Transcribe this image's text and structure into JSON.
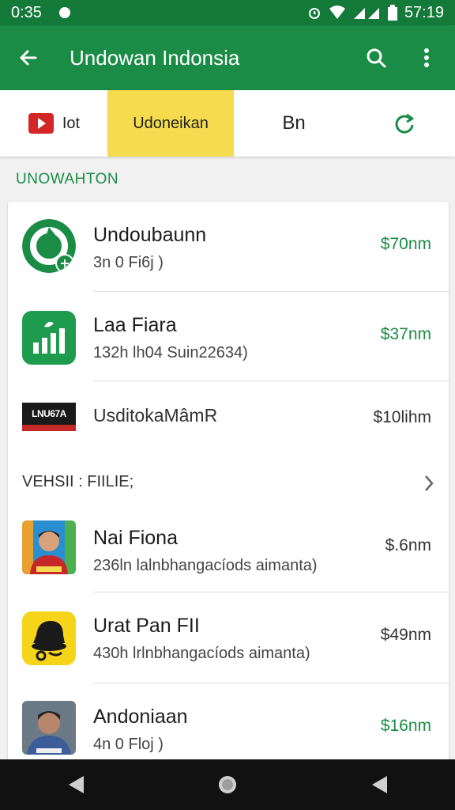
{
  "status_bar": {
    "left_time": "0:35",
    "right_time": "57:19",
    "icons": [
      "dot-icon",
      "alarm-icon",
      "wifi-icon",
      "signal-icon",
      "battery-icon"
    ]
  },
  "app_bar": {
    "title": "Undowan Indonsia",
    "icons": [
      "back-arrow-icon",
      "search-icon",
      "more-vert-icon"
    ]
  },
  "tabs": [
    {
      "label": "Iot",
      "icon": "play-icon",
      "active": false
    },
    {
      "label": "Udoneikan",
      "active": true
    },
    {
      "label": "Bn",
      "active": false
    },
    {
      "icon": "refresh-icon",
      "active": false
    }
  ],
  "section": {
    "title": "UNOWAHTON"
  },
  "list": {
    "items": [
      {
        "title": "Undoubaunn",
        "subtitle": "3n 0 Fi6j )",
        "price": "$70nm",
        "icon": "circle-logo-icon"
      },
      {
        "title": "Laa Fiara",
        "subtitle": "132h lh04 Suin22634)",
        "price": "$37nm",
        "icon": "bar-chart-icon"
      },
      {
        "title": "UsditokaMâmR",
        "price": "$10lihm",
        "icon": "brand-logo-icon",
        "logo_text": "LNU67A"
      },
      {
        "title": "Nai Fiona",
        "subtitle": "236ln lalnbhangacíods aimanta)",
        "price": "$.6nm",
        "icon": "person-photo-icon"
      },
      {
        "title": "Urat Pan FII",
        "subtitle": "430h lrlnbhangacíods aimanta)",
        "price": "$49nm",
        "icon": "yellow-character-icon"
      },
      {
        "title": "Andoniaan",
        "subtitle": "4n 0 Floj )",
        "price": "$16nm",
        "icon": "person-photo-icon"
      }
    ],
    "group_header": {
      "label": "VEHSII : FIILIE;"
    }
  },
  "colors": {
    "primary": "#1a8c46",
    "primary_dark": "#137a3a",
    "accent_tab": "#f4dc4e",
    "price_green": "#1a8c46"
  },
  "nav_bar": {
    "icons": [
      "back-icon",
      "home-icon",
      "recents-icon"
    ]
  }
}
